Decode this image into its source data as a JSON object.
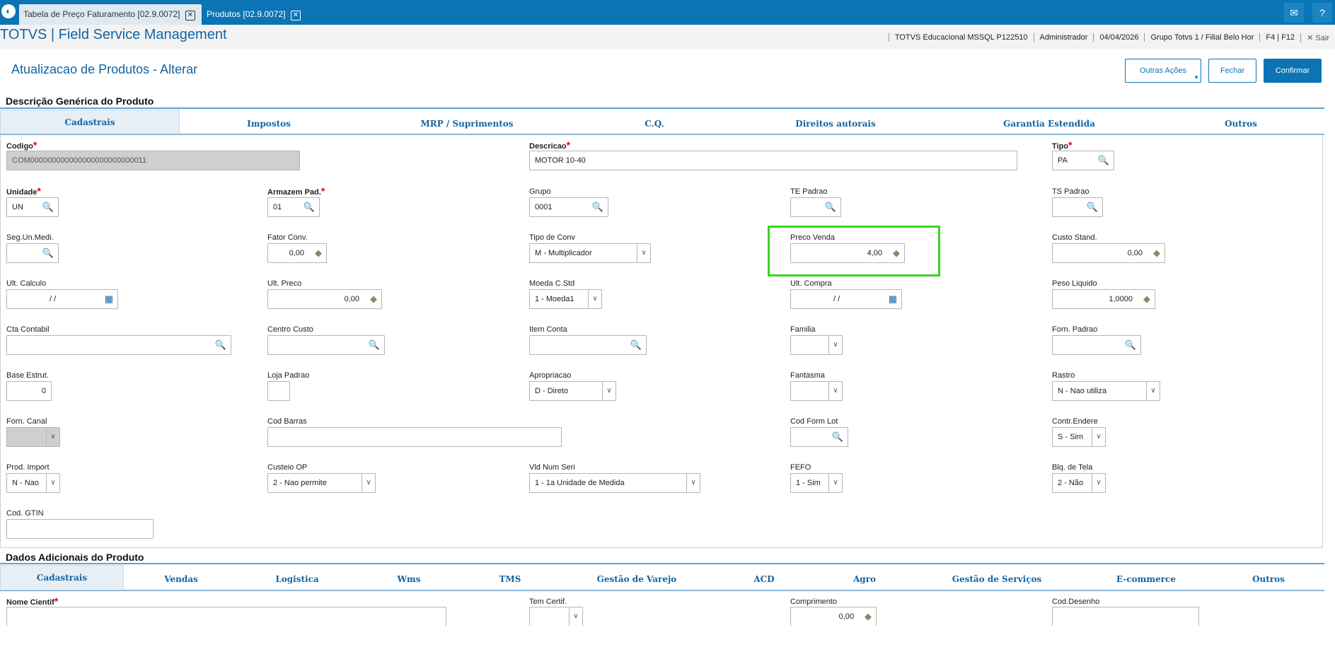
{
  "topbar": {
    "tabs": [
      {
        "label": "Tabela de Preço Faturamento [02.9.0072]"
      },
      {
        "label": "Produtos [02.9.0072]"
      }
    ],
    "logo_icon": "totvs-logo-icon",
    "mail_icon": "mail-icon",
    "help_icon": "help-icon"
  },
  "header": {
    "app_title": "TOTVS | Field Service Management",
    "status": [
      "TOTVS Educacional MSSQL P122510",
      "Administrador",
      "04/04/2026",
      "Grupo Totvs 1 / Filial Belo Hor",
      "F4 | F12"
    ],
    "exit_label": "✕ Sair"
  },
  "page": {
    "title": "Atualizacao de Produtos - Alterar",
    "buttons": {
      "outras": "Outras Ações",
      "fechar": "Fechar",
      "confirmar": "Confirmar"
    }
  },
  "section1": {
    "title": "Descrição Genérica do Produto",
    "tabs": [
      "Cadastrais",
      "Impostos",
      "MRP / Suprimentos",
      "C.Q.",
      "Direitos autorais",
      "Garantia Estendida",
      "Outros"
    ]
  },
  "fields": {
    "codigo": {
      "label": "Codigo",
      "value": "COM000000000000000000000000011"
    },
    "descricao": {
      "label": "Descricao",
      "value": "MOTOR 10-40"
    },
    "tipo": {
      "label": "Tipo",
      "value": "PA"
    },
    "unidade": {
      "label": "Unidade",
      "value": "UN"
    },
    "armazem": {
      "label": "Armazem Pad.",
      "value": "01"
    },
    "grupo": {
      "label": "Grupo",
      "value": "0001"
    },
    "te_padrao": {
      "label": "TE Padrao",
      "value": ""
    },
    "ts_padrao": {
      "label": "TS Padrao",
      "value": ""
    },
    "seg_un": {
      "label": "Seg.Un.Medi.",
      "value": ""
    },
    "fator_conv": {
      "label": "Fator Conv.",
      "value": "0,00"
    },
    "tipo_conv": {
      "label": "Tipo de Conv",
      "value": "M - Multiplicador"
    },
    "preco_venda": {
      "label": "Preco Venda",
      "value": "4,00"
    },
    "custo_stand": {
      "label": "Custo Stand.",
      "value": "0,00"
    },
    "ult_calculo": {
      "label": "Ult. Calculo",
      "value": "/ /"
    },
    "ult_preco": {
      "label": "Ult. Preco",
      "value": "0,00"
    },
    "moeda": {
      "label": "Moeda C.Std",
      "value": "1 - Moeda1"
    },
    "ult_compra": {
      "label": "Ult. Compra",
      "value": "/ /"
    },
    "peso_liquido": {
      "label": "Peso Liquido",
      "value": "1,0000"
    },
    "cta_contabil": {
      "label": "Cta Contabil",
      "value": ""
    },
    "centro_custo": {
      "label": "Centro Custo",
      "value": ""
    },
    "item_conta": {
      "label": "Item Conta",
      "value": ""
    },
    "familia": {
      "label": "Familia",
      "value": ""
    },
    "forn_padrao": {
      "label": "Forn. Padrao",
      "value": ""
    },
    "base_estrut": {
      "label": "Base Estrut.",
      "value": "0"
    },
    "loja_padrao": {
      "label": "Loja Padrao",
      "value": ""
    },
    "apropriacao": {
      "label": "Apropriacao",
      "value": "D - Direto"
    },
    "fantasma": {
      "label": "Fantasma",
      "value": ""
    },
    "rastro": {
      "label": "Rastro",
      "value": "N - Nao utiliza"
    },
    "forn_canal": {
      "label": "Forn. Canal",
      "value": ""
    },
    "cod_barras": {
      "label": "Cod Barras",
      "value": ""
    },
    "cod_form_lot": {
      "label": "Cod Form Lot",
      "value": ""
    },
    "contr_endere": {
      "label": "Contr.Endere",
      "value": "S - Sim"
    },
    "prod_import": {
      "label": "Prod. Import",
      "value": "N - Nao"
    },
    "custeio_op": {
      "label": "Custeio OP",
      "value": "2 - Nao permite"
    },
    "vld_num_seri": {
      "label": "Vld Num Seri",
      "value": "1 - 1a Unidade de Medida"
    },
    "fefo": {
      "label": "FEFO",
      "value": "1 - Sim"
    },
    "blq_tela": {
      "label": "Blq. de Tela",
      "value": "2 - Não"
    },
    "cod_gtin": {
      "label": "Cod. GTIN",
      "value": ""
    }
  },
  "section2": {
    "title": "Dados Adicionais do Produto",
    "tabs": [
      "Cadastrais",
      "Vendas",
      "Logistica",
      "Wms",
      "TMS",
      "Gestão de Varejo",
      "ACD",
      "Agro",
      "Gestão de Serviços",
      "E-commerce",
      "Outros"
    ],
    "fields": {
      "nome_cientif": {
        "label": "Nome Cientif",
        "value": ""
      },
      "tem_certif": {
        "label": "Tem Certif.",
        "value": ""
      },
      "comprimento": {
        "label": "Comprimento",
        "value": "0,00"
      },
      "cod_desenho": {
        "label": "Cod.Desenho",
        "value": ""
      }
    }
  },
  "icons": {
    "lookup": "magnifier-icon",
    "calc": "calculator-icon",
    "calendar": "calendar-icon",
    "dropdown": "chevron-down-icon"
  },
  "colors": {
    "brand": "#0b74b4",
    "highlight": "#39d51e",
    "required": "#e00000"
  }
}
